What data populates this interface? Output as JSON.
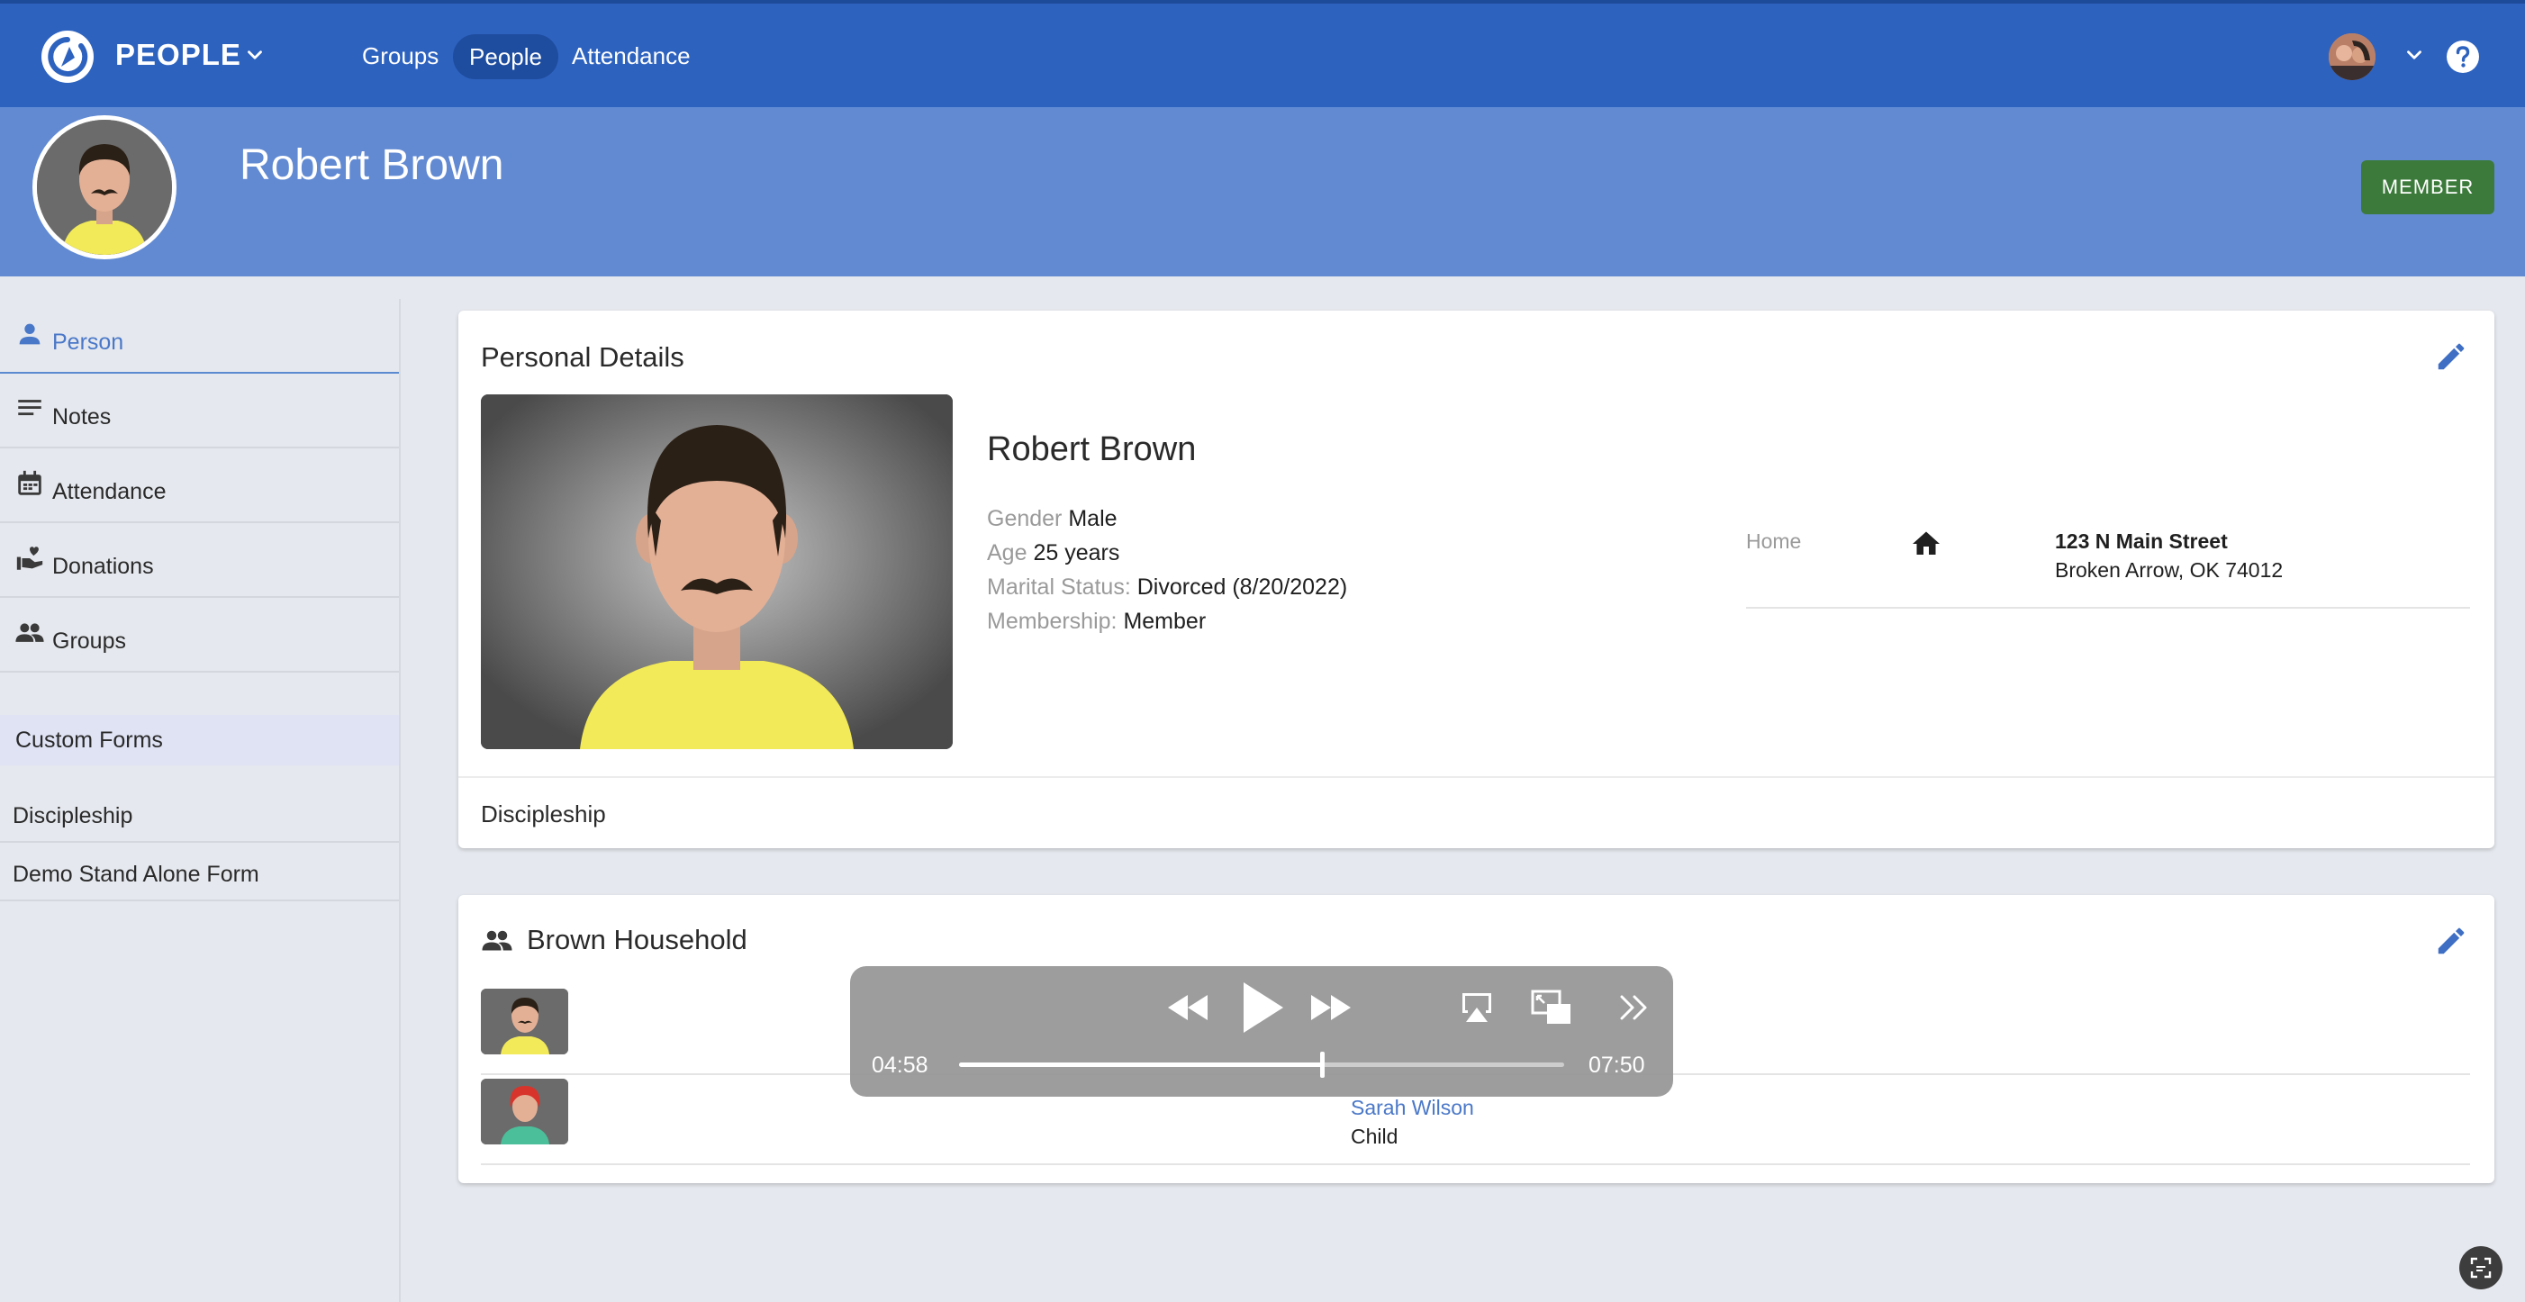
{
  "app": {
    "title": "PEOPLE",
    "nav": [
      {
        "label": "Groups",
        "active": false
      },
      {
        "label": "People",
        "active": true
      },
      {
        "label": "Attendance",
        "active": false
      }
    ]
  },
  "icons": {
    "logo": "app-logo-icon",
    "app_menu": "chevron-down-icon",
    "user_menu": "chevron-down-icon",
    "help": "help-circle-icon",
    "edit": "pencil-icon",
    "home": "home-icon",
    "household": "group-icon",
    "rewind": "rewind-icon",
    "play": "play-icon",
    "forward": "fast-forward-icon",
    "airplay": "airplay-icon",
    "pip": "picture-in-picture-icon",
    "more": "double-chevron-right-icon"
  },
  "profile": {
    "name": "Robert Brown",
    "badge": "MEMBER"
  },
  "sidebar": {
    "items": [
      {
        "label": "Person",
        "icon": "person-icon",
        "active": true
      },
      {
        "label": "Notes",
        "icon": "notes-icon",
        "active": false
      },
      {
        "label": "Attendance",
        "icon": "calendar-icon",
        "active": false
      },
      {
        "label": "Donations",
        "icon": "donation-hand-icon",
        "active": false
      },
      {
        "label": "Groups",
        "icon": "group-icon",
        "active": false
      }
    ],
    "custom_forms_header": "Custom Forms",
    "forms": [
      {
        "label": "Discipleship"
      },
      {
        "label": "Demo Stand Alone Form"
      }
    ]
  },
  "details": {
    "title": "Personal Details",
    "name": "Robert Brown",
    "gender_label": "Gender",
    "gender": "Male",
    "age_label": "Age",
    "age": "25 years",
    "marital_label": "Marital Status:",
    "marital": "Divorced (8/20/2022)",
    "membership_label": "Membership:",
    "membership": "Member",
    "address": {
      "label": "Home",
      "line1": "123 N Main Street",
      "line2": "Broken Arrow, OK 74012"
    },
    "footer": "Discipleship"
  },
  "household": {
    "title": "Brown Household",
    "members": [
      {
        "name": "",
        "role": ""
      },
      {
        "name": "Sarah Wilson",
        "role": "Child"
      }
    ]
  },
  "player": {
    "elapsed": "04:58",
    "remaining": "07:50",
    "progress": 0.6
  },
  "colors": {
    "topbar": "#2d62bf",
    "banner": "#618ad3",
    "accent": "#4a78c8",
    "member_badge": "#3b7a3a"
  }
}
